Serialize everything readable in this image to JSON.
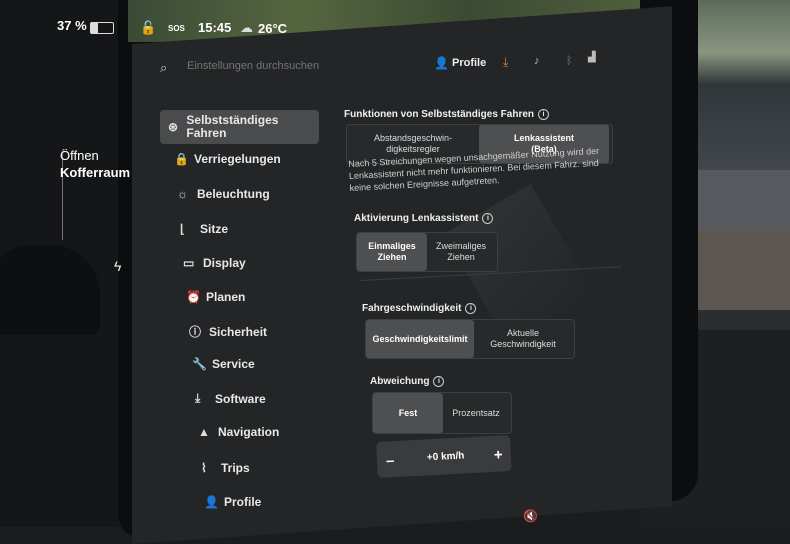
{
  "status_bar": {
    "battery_percent": "37 %",
    "battery_level": 0.34,
    "time": "15:45",
    "sos": "SOS",
    "temperature": "26°C"
  },
  "car_panel": {
    "trunk_line1": "Öffnen",
    "trunk_line2": "Kofferraum"
  },
  "header": {
    "search_placeholder": "Einstellungen durchsuchen",
    "profile_label": "Profile"
  },
  "sidebar": {
    "items": [
      {
        "label": "Selbstständiges Fahren",
        "icon": "steering-wheel-icon",
        "active": true
      },
      {
        "label": "Verriegelungen",
        "icon": "lock-icon"
      },
      {
        "label": "Beleuchtung",
        "icon": "sun-icon"
      },
      {
        "label": "Sitze",
        "icon": "seat-icon"
      },
      {
        "label": "Display",
        "icon": "display-icon"
      },
      {
        "label": "Planen",
        "icon": "alarm-clock-icon"
      },
      {
        "label": "Sicherheit",
        "icon": "info-circle-icon"
      },
      {
        "label": "Service",
        "icon": "wrench-icon"
      },
      {
        "label": "Software",
        "icon": "download-icon"
      },
      {
        "label": "Navigation",
        "icon": "navigation-arrow-icon"
      },
      {
        "label": "Trips",
        "icon": "trips-icon"
      },
      {
        "label": "Profile",
        "icon": "person-icon"
      }
    ]
  },
  "main": {
    "autopilot_heading": "Funktionen von Selbstständiges Fahren",
    "autopilot_options": [
      "Abstandsgeschwin-\ndigkeitsregler",
      "Lenkassistent\n(Beta)"
    ],
    "autopilot_note": "Nach 5 Streichungen wegen unsachgemäßer Nutzung wird der Lenkassistent nicht mehr funktionieren. Bei diesem Fahrz. sind keine solchen Ereignisse aufgetreten.",
    "activation_heading": "Aktivierung Lenkassistent",
    "activation_options": [
      "Einmaliges\nZiehen",
      "Zweimaliges\nZiehen"
    ],
    "speed_heading": "Fahrgeschwindigkeit",
    "speed_options": [
      "Geschwindigkeitslimit",
      "Aktuelle\nGeschwindigkeit"
    ],
    "offset_heading": "Abweichung",
    "offset_options": [
      "Fest",
      "Prozentsatz"
    ],
    "offset_value": "+0 km/h",
    "minus": "–",
    "plus": "+"
  }
}
